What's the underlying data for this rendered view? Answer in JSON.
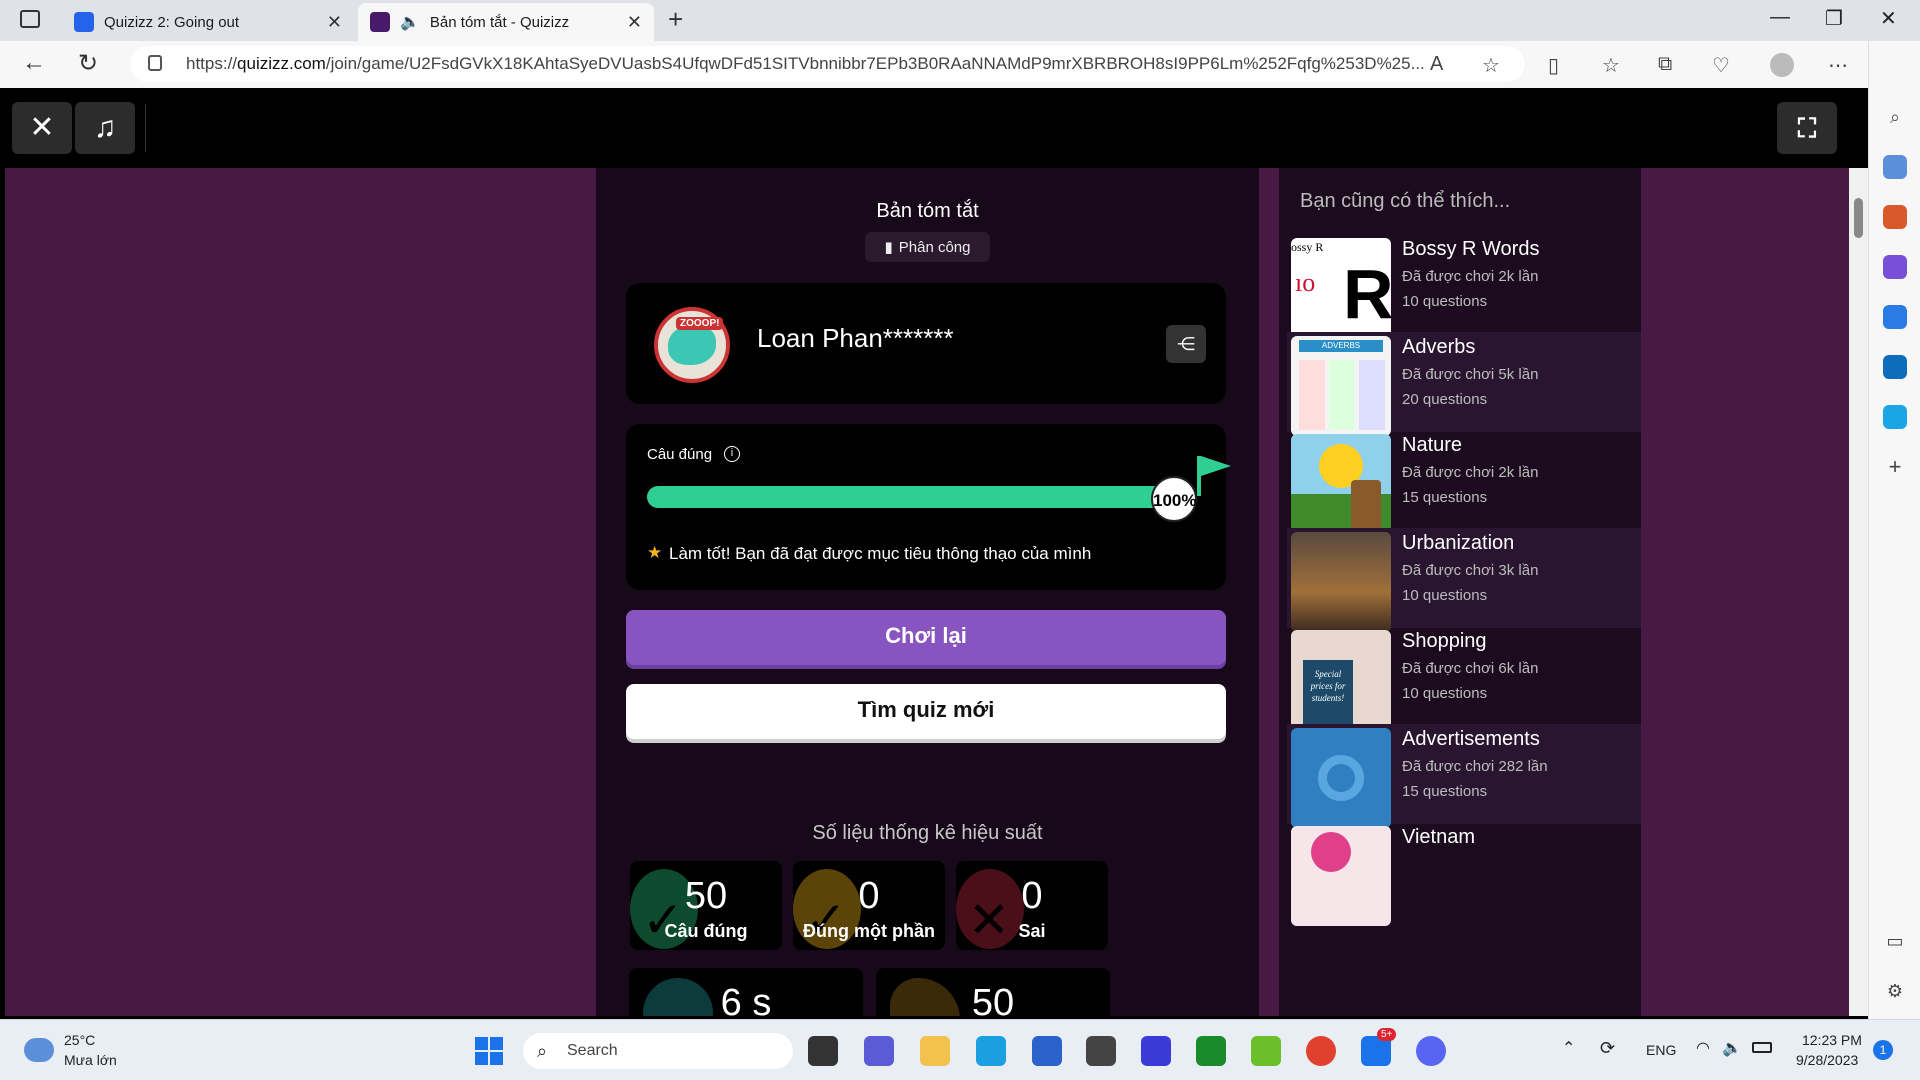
{
  "browser": {
    "tabs": [
      {
        "title": "Quizizz 2: Going out",
        "active": false
      },
      {
        "title": "Bản tóm tắt - Quizizz",
        "active": true
      }
    ],
    "url_prefix": "https://",
    "url_host": "quizizz.com",
    "url_path": "/join/game/U2FsdGVkX18KAhtaSyeDVUasbS4UfqwDFd51SITVbnnibbr7EPb3B0RAaNNAMdP9mrXBRBROH8sI9PP6Lm%252Fqfg%253D%25..."
  },
  "summary": {
    "title": "Bản tóm tắt",
    "assignment_chip": "Phân công"
  },
  "profile": {
    "name": "Loan Phan*******",
    "avatar_tag": "ZOOOP!"
  },
  "accuracy": {
    "label": "Câu đúng",
    "percent": 100,
    "percent_label": "100%",
    "goal_message": "Làm tốt! Bạn đã đạt được mục tiêu thông thạo của mình"
  },
  "actions": {
    "replay": "Chơi lại",
    "new_quiz": "Tìm quiz mới"
  },
  "stats": {
    "title": "Số liệu thống kê hiệu suất",
    "correct": {
      "value": "50",
      "label": "Câu đúng"
    },
    "partial": {
      "value": "0",
      "label": "Đúng một phần"
    },
    "incorrect": {
      "value": "0",
      "label": "Sai"
    },
    "time": {
      "value": "6 s"
    },
    "streak": {
      "value": "50"
    }
  },
  "recommendations": {
    "title": "Bạn cũng có thể thích...",
    "items": [
      {
        "title": "Bossy R Words",
        "plays": "Đã được chơi 2k lần",
        "questions": "10 questions"
      },
      {
        "title": "Adverbs",
        "plays": "Đã được chơi 5k lần",
        "questions": "20 questions"
      },
      {
        "title": "Nature",
        "plays": "Đã được chơi 2k lần",
        "questions": "15 questions"
      },
      {
        "title": "Urbanization",
        "plays": "Đã được chơi 3k lần",
        "questions": "10 questions"
      },
      {
        "title": "Shopping",
        "plays": "Đã được chơi 6k lần",
        "questions": "10 questions"
      },
      {
        "title": "Advertisements",
        "plays": "Đã được chơi 282 lần",
        "questions": "15 questions"
      },
      {
        "title": "Vietnam",
        "plays": "",
        "questions": ""
      }
    ],
    "thumb_texts": {
      "bossy": "ossy R",
      "adverbs": "ADVERBS",
      "shopping": "Special prices for students!"
    }
  },
  "taskbar": {
    "weather_temp": "25°C",
    "weather_desc": "Mưa lớn",
    "search_placeholder": "Search",
    "language": "ENG",
    "time": "12:23 PM",
    "date": "9/28/2023",
    "notification_count": "1",
    "zalo_badge": "5+"
  },
  "colors": {
    "page_bg": "#461a42",
    "panel_bg": "#17091a",
    "accent_purple": "#8854c0",
    "progress_green": "#2fce92"
  }
}
